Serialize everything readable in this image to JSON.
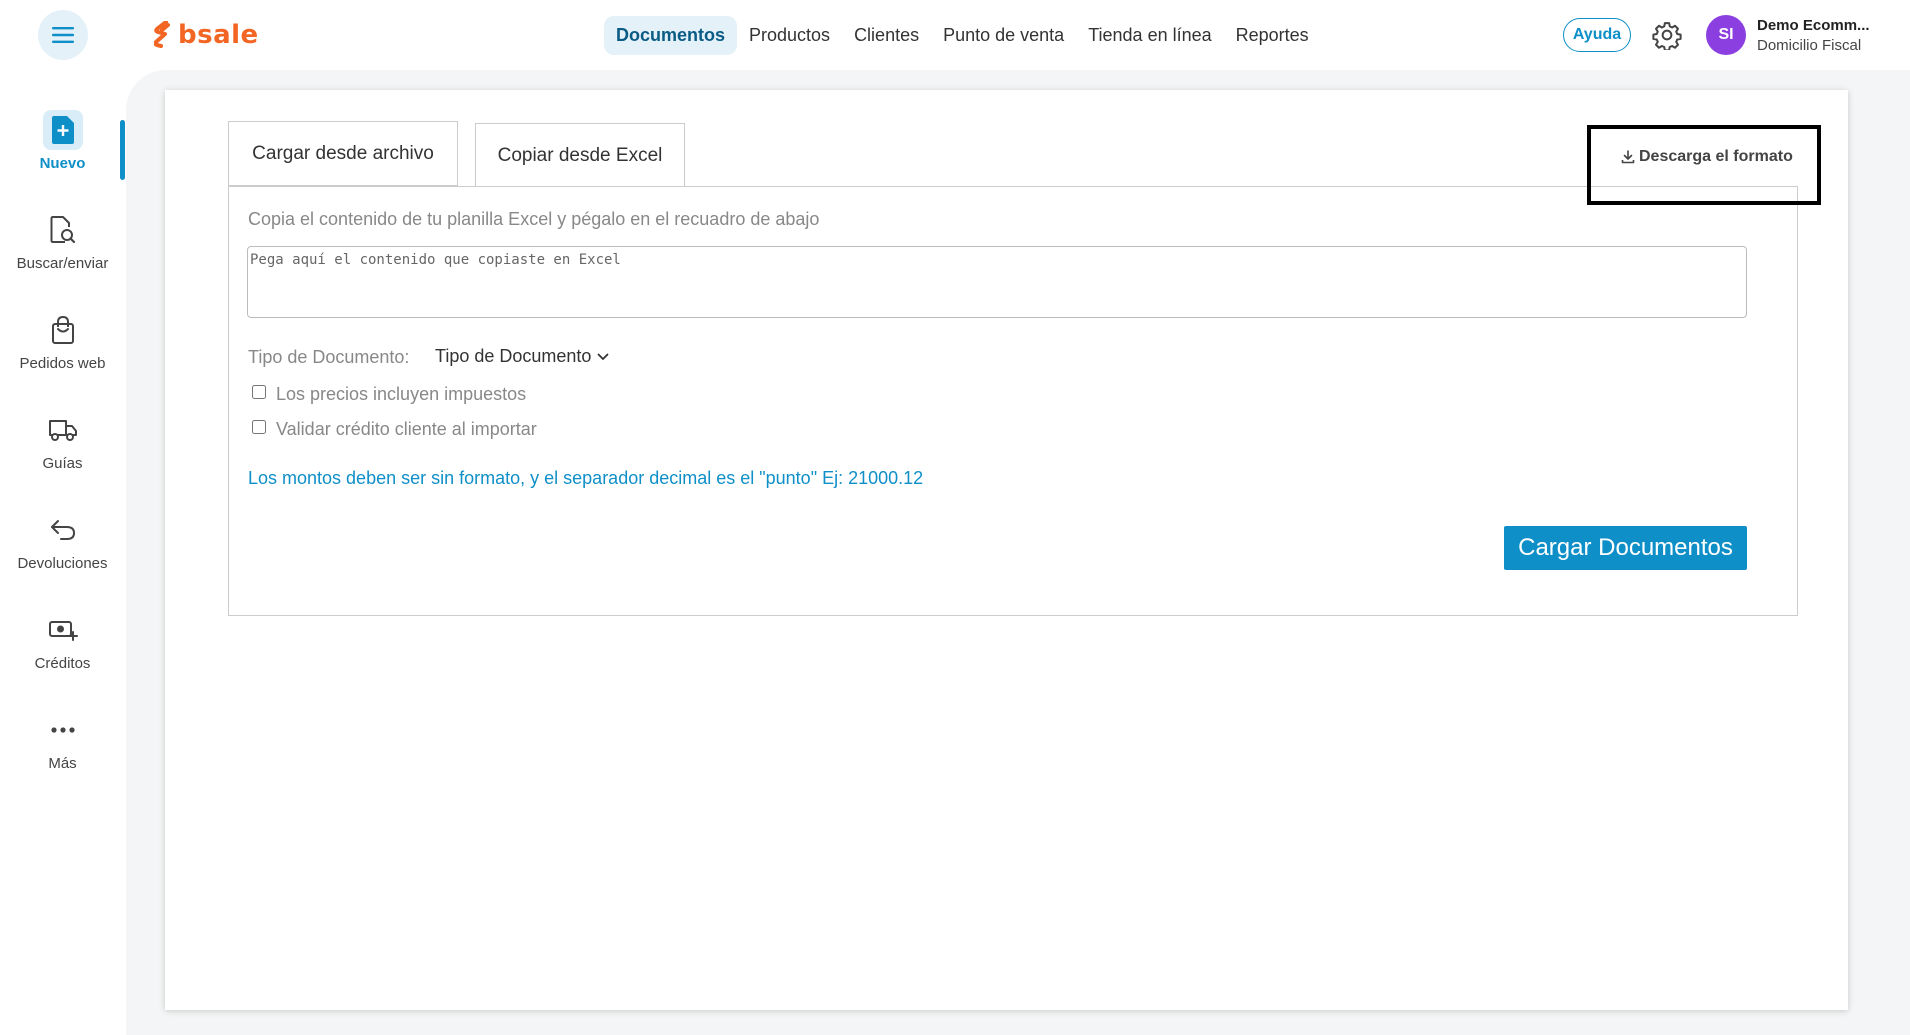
{
  "header": {
    "brand": "bsale",
    "nav": [
      {
        "label": "Documentos",
        "active": true
      },
      {
        "label": "Productos",
        "active": false
      },
      {
        "label": "Clientes",
        "active": false
      },
      {
        "label": "Punto de venta",
        "active": false
      },
      {
        "label": "Tienda en línea",
        "active": false
      },
      {
        "label": "Reportes",
        "active": false
      }
    ],
    "help_label": "Ayuda",
    "user": {
      "initials": "SI",
      "name": "Demo Ecomm...",
      "subtitle": "Domicilio Fiscal"
    }
  },
  "sidebar": {
    "items": [
      {
        "label": "Nuevo",
        "icon": "new-document-icon",
        "active": true
      },
      {
        "label": "Buscar/enviar",
        "icon": "search-document-icon",
        "active": false
      },
      {
        "label": "Pedidos web",
        "icon": "shopping-bag-icon",
        "active": false
      },
      {
        "label": "Guías",
        "icon": "truck-icon",
        "active": false
      },
      {
        "label": "Devoluciones",
        "icon": "return-arrow-icon",
        "active": false
      },
      {
        "label": "Créditos",
        "icon": "money-plus-icon",
        "active": false
      },
      {
        "label": "Más",
        "icon": "more-dots-icon",
        "active": false
      }
    ]
  },
  "main": {
    "tabs": [
      {
        "label": "Cargar desde archivo",
        "active": false
      },
      {
        "label": "Copiar desde Excel",
        "active": true
      }
    ],
    "download_label": "Descarga el formato",
    "instructions": "Copia el contenido de tu planilla Excel y pégalo en el recuadro de abajo",
    "paste_placeholder": "Pega aquí el contenido que copiaste en Excel",
    "doc_type_label": "Tipo de Documento:",
    "doc_type_value": "Tipo de Documento",
    "checkbox_taxes": "Los precios incluyen impuestos",
    "checkbox_credit": "Validar crédito cliente al importar",
    "note": "Los montos deben ser sin formato, y el separador decimal es el \"punto\" Ej: 21000.12",
    "submit_label": "Cargar Documentos"
  },
  "colors": {
    "brand": "#f26522",
    "accent": "#0f8fc8",
    "avatar": "#8b3fe0"
  }
}
